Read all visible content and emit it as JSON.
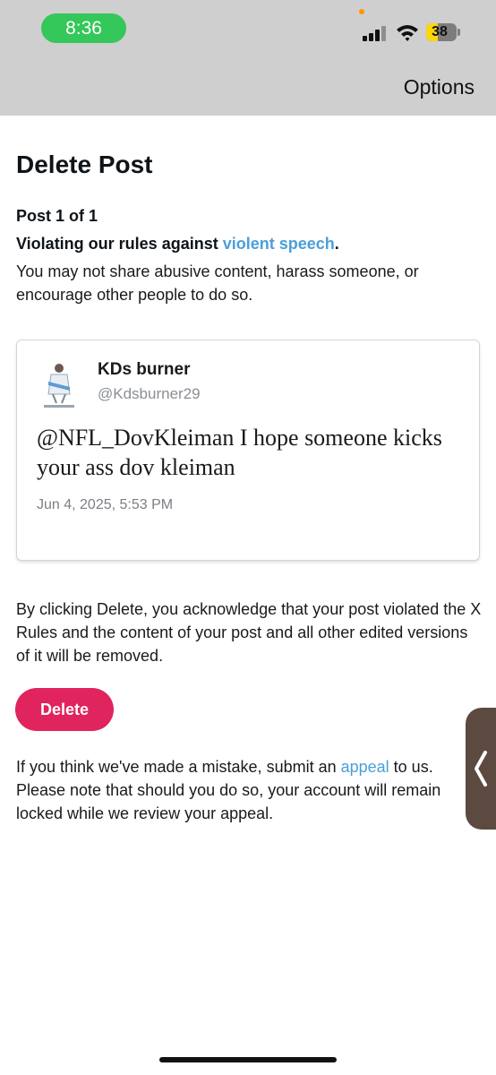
{
  "status_bar": {
    "time": "8:36",
    "battery_level": "38",
    "battery_fraction": 0.38,
    "signal_bars_active": 3
  },
  "header": {
    "options_label": "Options"
  },
  "page": {
    "title": "Delete Post",
    "post_count": "Post 1 of 1",
    "rule_prefix": "Violating our rules against ",
    "rule_link": "violent speech",
    "rule_suffix": ".",
    "rule_description": "You may not share abusive content, harass someone, or encourage other people to do so."
  },
  "post": {
    "display_name": "KDs burner",
    "handle": "@Kdsburner29",
    "text": "@NFL_DovKleiman I hope someone kicks your ass dov kleiman",
    "date": "Jun 4, 2025, 5:53 PM"
  },
  "acknowledgement": "By clicking Delete, you acknowledge that your post violated the X Rules and the content of your post and all other edited versions of it will be removed.",
  "delete_label": "Delete",
  "appeal": {
    "prefix": "If you think we've made a mistake, submit an ",
    "link": "appeal",
    "suffix": " to us. Please note that should you do so, your account will remain locked while we review your appeal."
  },
  "colors": {
    "accent_link": "#4a9fd8",
    "delete_button": "#e0245e",
    "time_pill": "#34c759",
    "battery": "#ffd60a"
  },
  "icons": [
    "signal-icon",
    "wifi-icon",
    "battery-icon",
    "avatar",
    "chevron-left-icon"
  ]
}
